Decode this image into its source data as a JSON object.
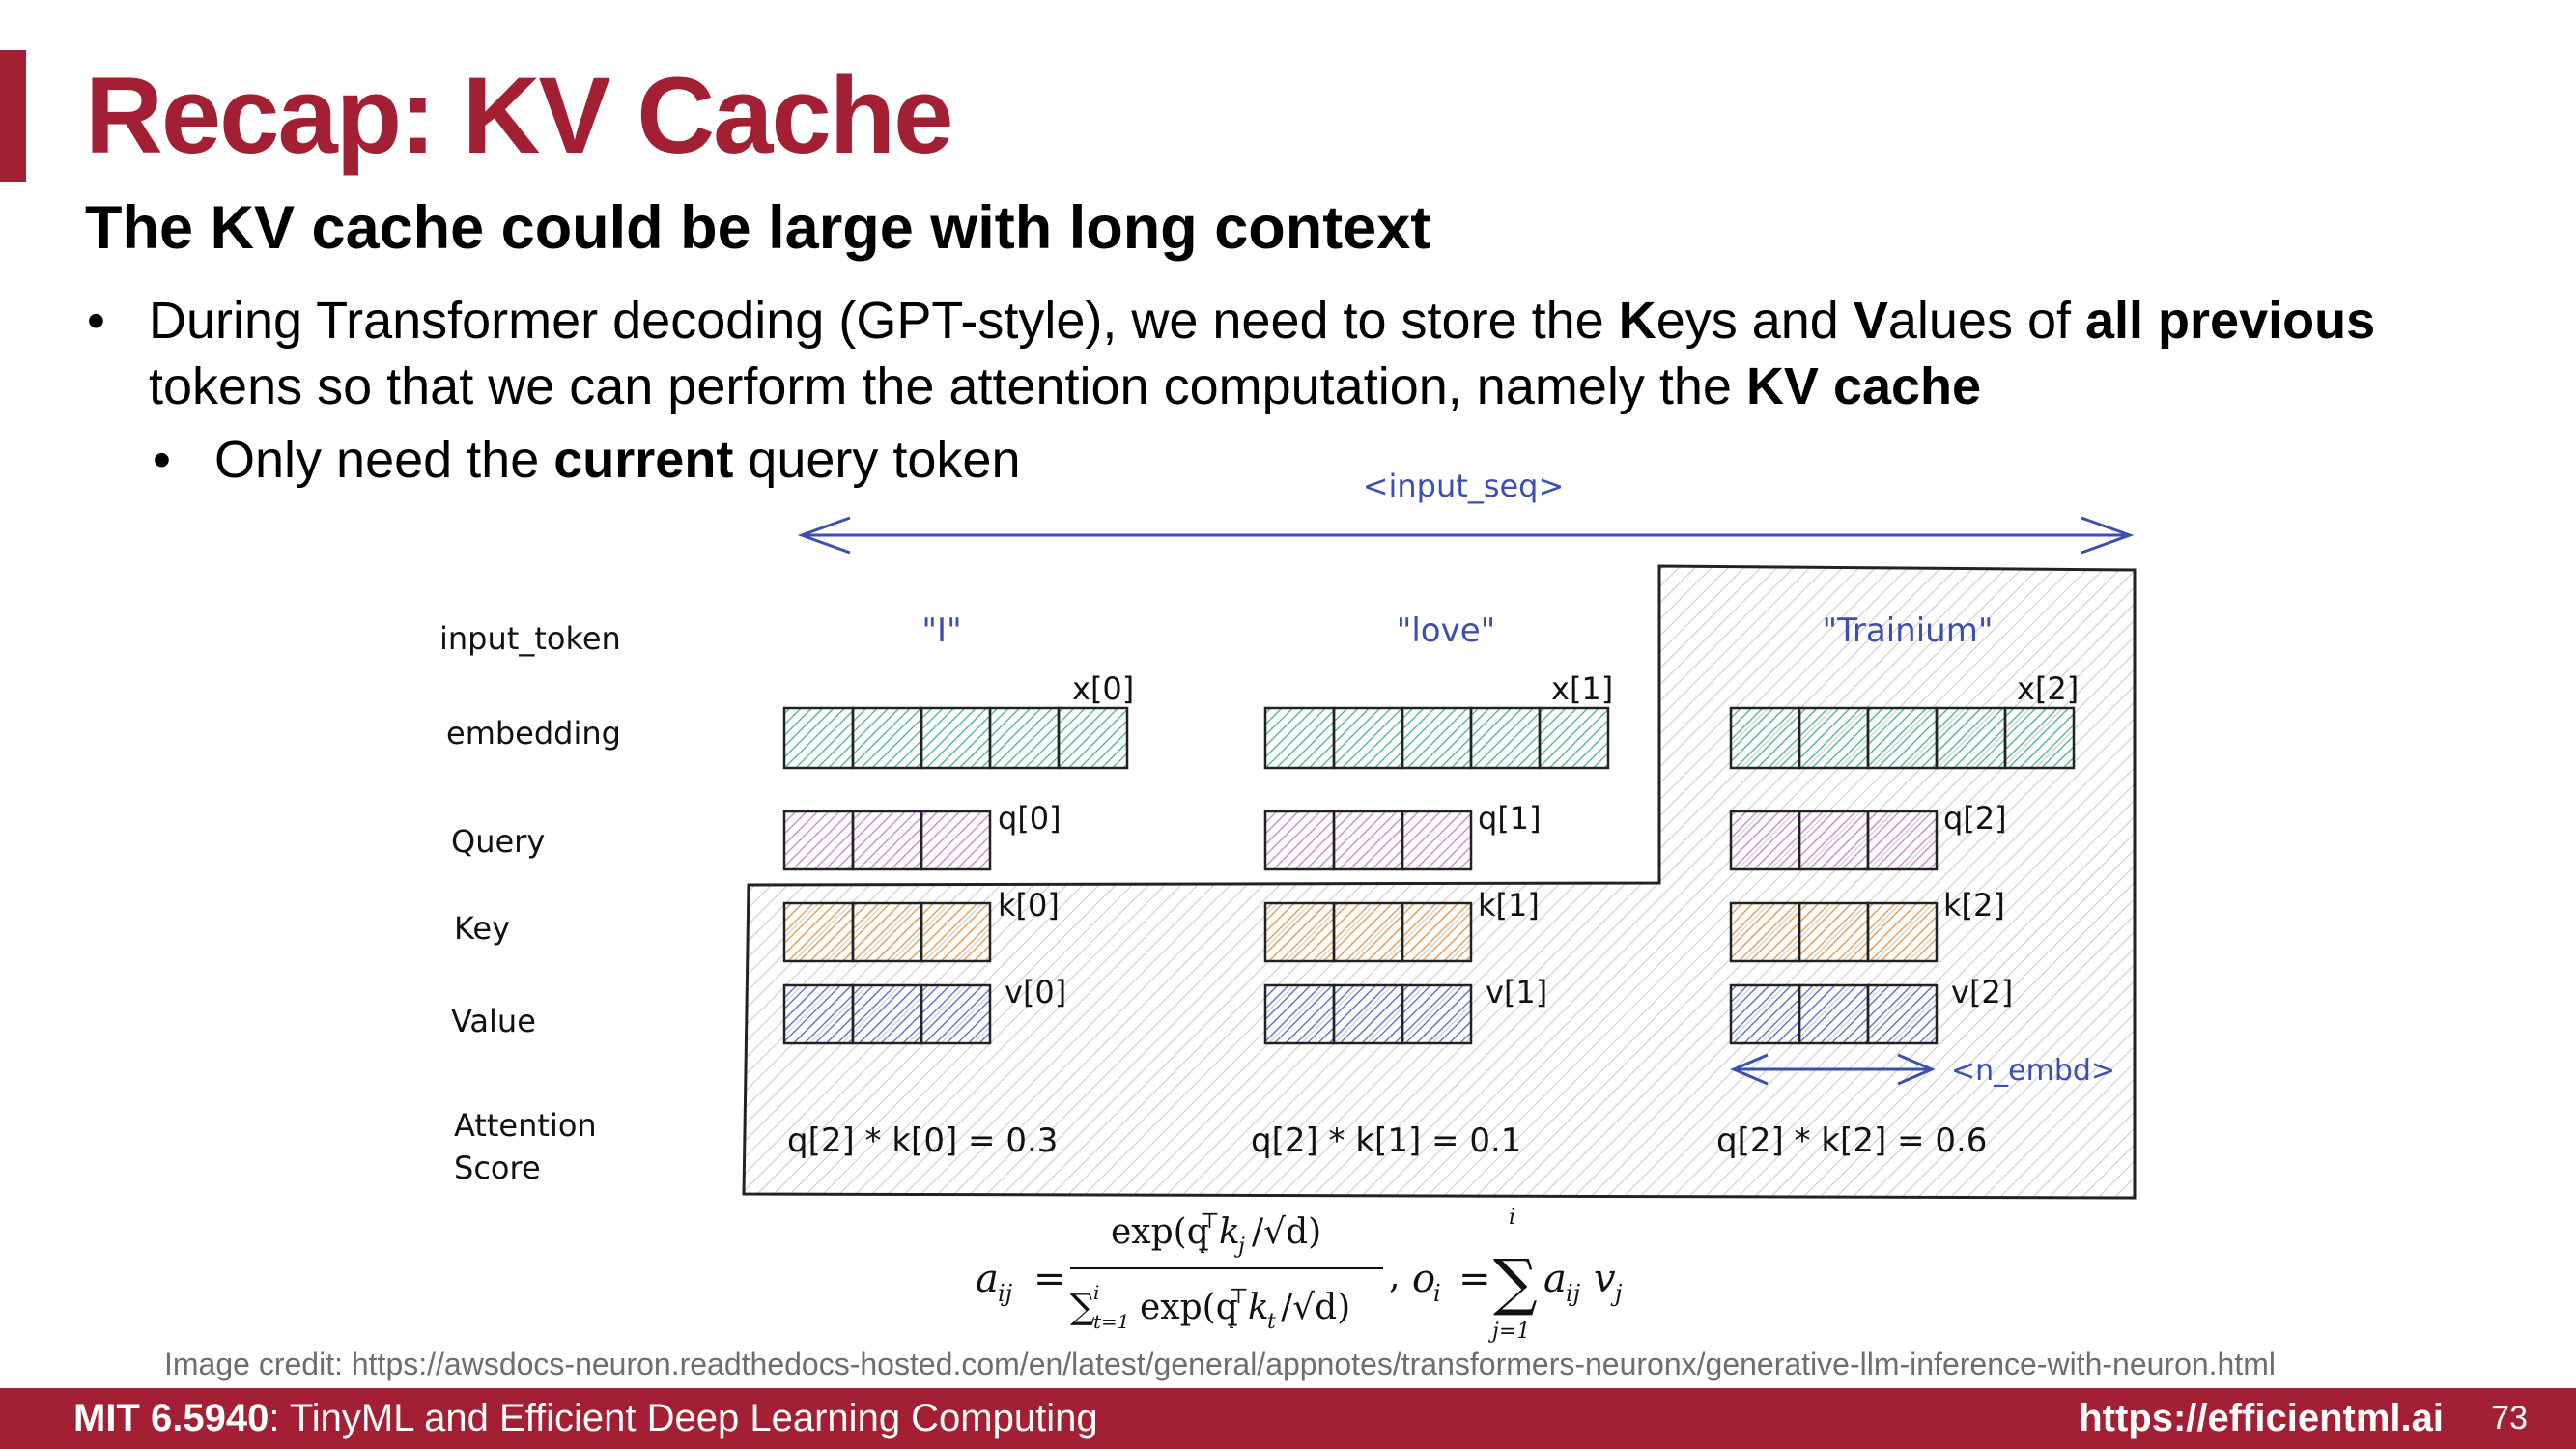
{
  "slide": {
    "title": "Recap: KV Cache",
    "subtitle": "The KV cache could be large with long context",
    "bullet1": {
      "p1": "During Transformer decoding (GPT-style), we need to store the ",
      "b1": "K",
      "p2": "eys and ",
      "b2": "V",
      "p3": "alues of ",
      "b3": "all previous",
      "p4": " tokens so that we can perform the attention computation, namely the ",
      "b4": "KV cache"
    },
    "bullet2": {
      "p1": "Only need the ",
      "b1": "current",
      "p2": " query token"
    }
  },
  "diagram": {
    "input_seq_label": "<input_seq>",
    "n_embd_label": "<n_embd>",
    "row_labels": {
      "input_token": "input_token",
      "embedding": "embedding",
      "query": "Query",
      "key": "Key",
      "value": "Value",
      "attention1": "Attention",
      "attention2": "Score"
    },
    "tokens": [
      {
        "word": "\"I\"",
        "x": "x[0]",
        "q": "q[0]",
        "k": "k[0]",
        "v": "v[0]",
        "score": "q[2] * k[0] = 0.3"
      },
      {
        "word": "\"love\"",
        "x": "x[1]",
        "q": "q[1]",
        "k": "k[1]",
        "v": "v[1]",
        "score": "q[2] * k[1] = 0.1"
      },
      {
        "word": "\"Trainium\"",
        "x": "x[2]",
        "q": "q[2]",
        "k": "k[2]",
        "v": "v[2]",
        "score": "q[2] * k[2] = 0.6"
      }
    ],
    "colors": {
      "embedding": "#3fb37f",
      "query": "#c77dd0",
      "key": "#e8913c",
      "value": "#4a63c7",
      "arrow": "#3a4fb0",
      "hatch_region": "#bdbdbd"
    }
  },
  "formula": {
    "lhs": "a",
    "lhs_sub": "ij",
    "eq": "=",
    "num": "exp(q",
    "num_sub": "i",
    "num_sup": "⊤",
    "num_k": "k",
    "num_k_sub": "j",
    "num_tail": "/√d)",
    "den_sum": "∑",
    "den_sup": "i",
    "den_sub": "t=1",
    "den_exp": "exp(q",
    "den_sub2": "i",
    "den_sup2": "⊤",
    "den_k": "k",
    "den_k_sub": "t",
    "den_tail": "/√d)",
    "comma": ",",
    "o": "o",
    "o_sub": "i",
    "eq2": "=",
    "sum": "∑",
    "sum_sup": "i",
    "sum_sub": "j=1",
    "term": "a",
    "term_sub": "ij",
    "term_v": "v",
    "term_v_sub": "j"
  },
  "credit": "Image credit: https://awsdocs-neuron.readthedocs-hosted.com/en/latest/general/appnotes/transformers-neuronx/generative-llm-inference-with-neuron.html",
  "footer": {
    "course_bold": "MIT 6.5940",
    "course_rest": ": TinyML and Efficient Deep Learning Computing",
    "url": "https://efficientml.ai",
    "page": "73"
  }
}
